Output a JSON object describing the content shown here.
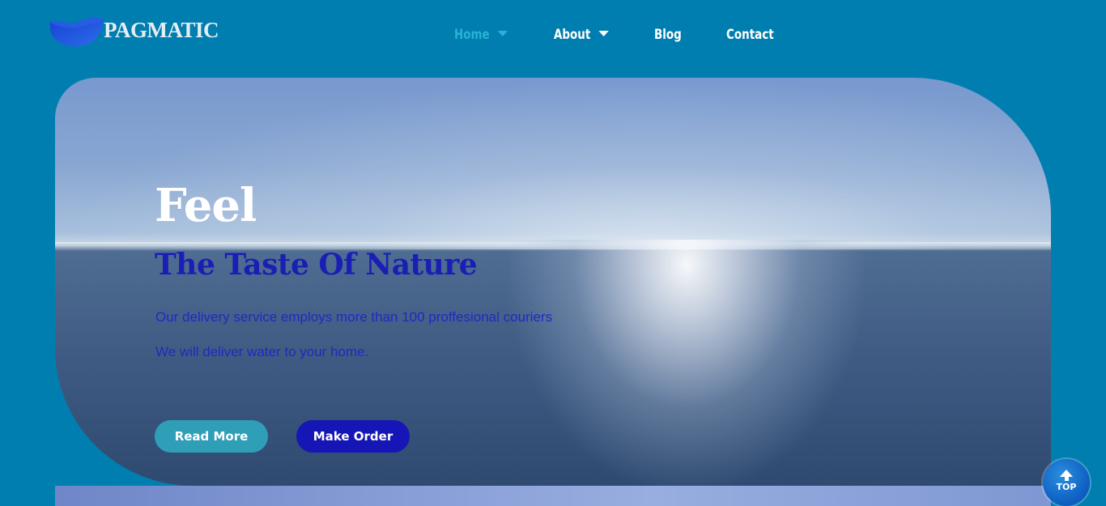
{
  "brand": {
    "name": "PAGMATIC",
    "logo_icon": "water-wave-logo"
  },
  "nav": {
    "items": [
      {
        "label": "Home",
        "active": true,
        "has_dropdown": true
      },
      {
        "label": "About",
        "active": false,
        "has_dropdown": true
      },
      {
        "label": "Blog",
        "active": false,
        "has_dropdown": false
      },
      {
        "label": "Contact",
        "active": false,
        "has_dropdown": false
      }
    ]
  },
  "hero": {
    "title": "Feel",
    "subtitle": "The Taste Of Nature",
    "line1": "Our delivery service employs more than 100 proffesional couriers",
    "line2": "We will deliver water to your home.",
    "read_more": "Read More",
    "make_order": "Make Order"
  },
  "scroll_top": {
    "label": "TOP",
    "icon": "arrow-up-icon"
  },
  "colors": {
    "page_bg": "#007eb0",
    "nav_active": "#28b2d6",
    "subtitle": "#1a1eb5",
    "read_more_bg": "#2f9fb8",
    "make_order_bg": "#1616b6"
  }
}
